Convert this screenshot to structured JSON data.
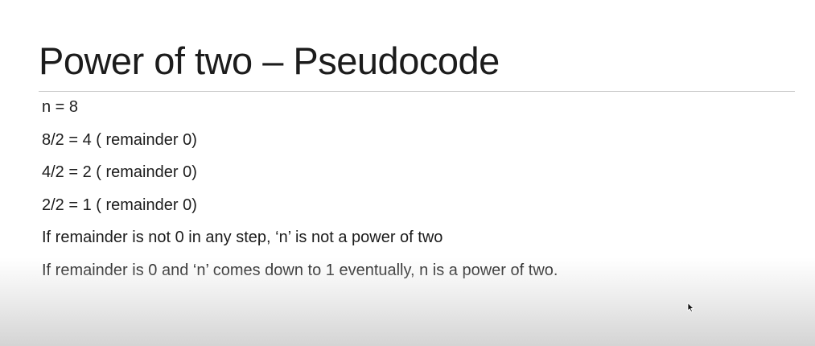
{
  "slide": {
    "title": "Power of two – Pseudocode",
    "lines": [
      "n = 8",
      "8/2 = 4 ( remainder 0)",
      "4/2 = 2 ( remainder 0)",
      "2/2 = 1 ( remainder 0)",
      "If remainder is not 0 in any step, ‘n’ is not a power of two",
      "If remainder is 0 and ‘n’ comes down to 1 eventually, n is a power of two."
    ]
  },
  "icons": {
    "cursor": "mouse-pointer-icon"
  }
}
